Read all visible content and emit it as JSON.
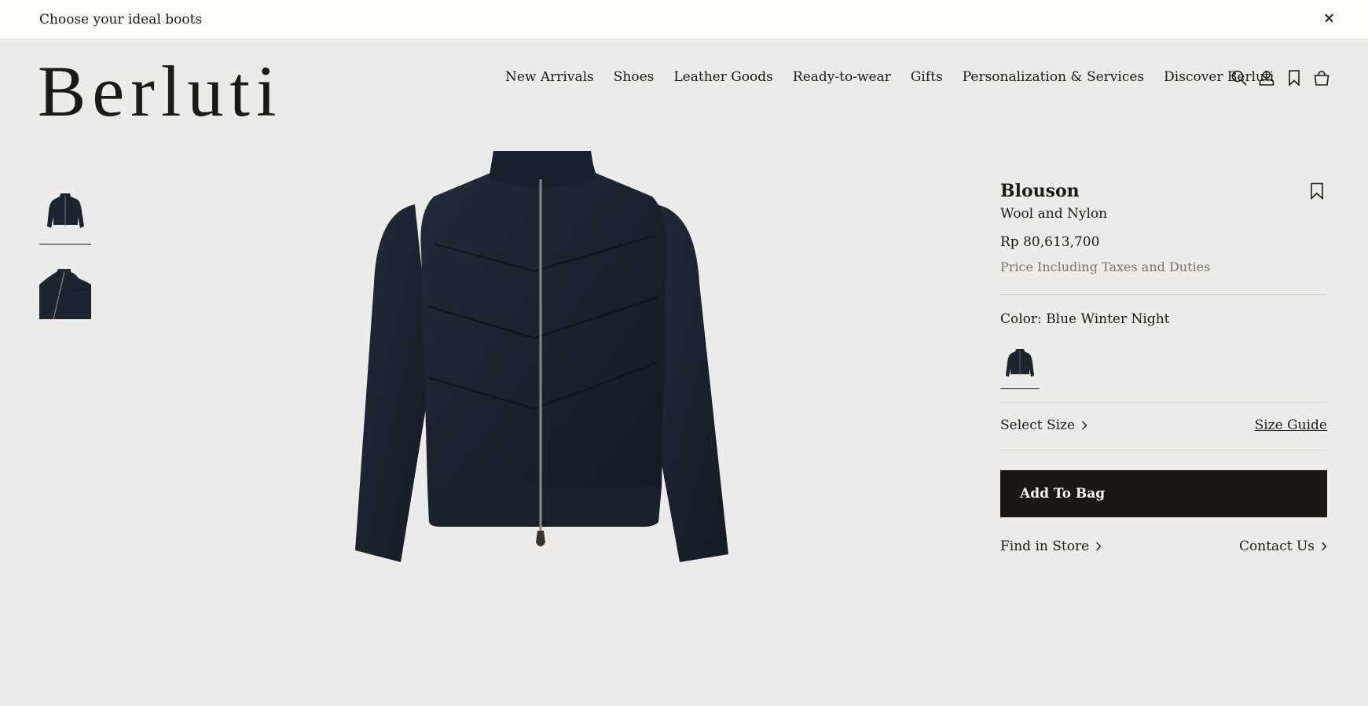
{
  "banner": {
    "text": "Choose your ideal boots",
    "close_icon": "close-icon"
  },
  "header": {
    "logo": "Berluti",
    "nav": [
      "New Arrivals",
      "Shoes",
      "Leather Goods",
      "Ready-to-wear",
      "Gifts",
      "Personalization & Services",
      "Discover Berluti"
    ],
    "icons": [
      "search-icon",
      "account-icon",
      "bookmark-icon",
      "bag-icon"
    ]
  },
  "gallery": {
    "thumbnails": [
      "jacket-front-thumbnail",
      "jacket-detail-thumbnail"
    ],
    "selected_index": 0
  },
  "product": {
    "name": "Blouson",
    "material": "Wool and Nylon",
    "price": "Rp 80,613,700",
    "tax_note": "Price Including Taxes and Duties",
    "color_label": "Color: Blue Winter Night",
    "select_size": "Select Size",
    "size_guide": "Size Guide",
    "add_to_bag": "Add To Bag",
    "find_in_store": "Find in Store",
    "contact_us": "Contact Us"
  },
  "colors": {
    "background": "#edebe9",
    "banner": "#fdfdf9",
    "button": "#1c1714",
    "jacket": "#1d2431",
    "muted_text": "#77736e"
  }
}
